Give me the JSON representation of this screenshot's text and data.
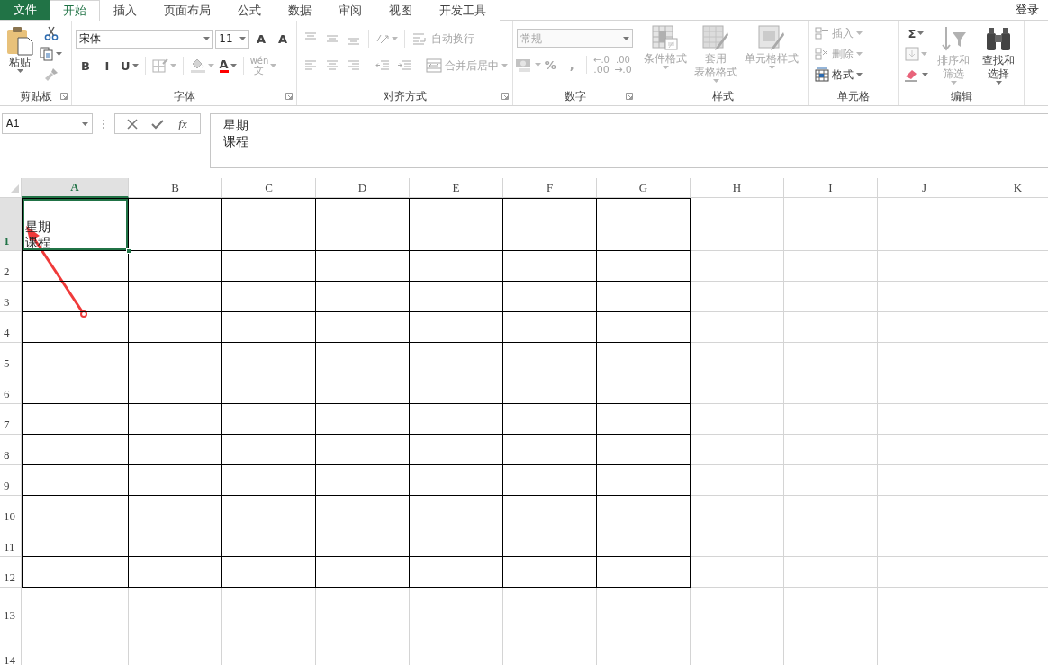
{
  "file_tab": "文件",
  "tabs": [
    {
      "label": "开始",
      "selected": true
    },
    {
      "label": "插入",
      "selected": false
    },
    {
      "label": "页面布局",
      "selected": false
    },
    {
      "label": "公式",
      "selected": false
    },
    {
      "label": "数据",
      "selected": false
    },
    {
      "label": "审阅",
      "selected": false
    },
    {
      "label": "视图",
      "selected": false
    },
    {
      "label": "开发工具",
      "selected": false
    }
  ],
  "account": "登录",
  "ribbon": [
    {
      "label": "剪贴板",
      "launcher": true,
      "stacks": [
        {
          "controls": [
            {
              "kind": "large",
              "lines": [
                "粘贴"
              ],
              "dropdown": true,
              "disabled": false
            }
          ]
        },
        {
          "controls": [
            {
              "kind": "icon",
              "disabled": false
            },
            {
              "kind": "icon",
              "dropdown": true,
              "disabled": false
            },
            {
              "kind": "icon",
              "disabled": true
            }
          ]
        }
      ]
    },
    {
      "label": "字体",
      "launcher": true,
      "lines": [
        {
          "controls": [
            {
              "kind": "combo",
              "value": "宋体",
              "wide": true,
              "disabled": false
            },
            {
              "kind": "combo",
              "value": "11",
              "disabled": false
            },
            {
              "kind": "glyph",
              "text": "A",
              "disabled": false
            },
            {
              "kind": "glyph",
              "text": "A",
              "disabled": false
            }
          ]
        },
        {
          "controls": [
            {
              "kind": "glyph",
              "text": "B",
              "disabled": false
            },
            {
              "kind": "glyph",
              "text": "I",
              "disabled": false
            },
            {
              "kind": "glyph",
              "text": "U",
              "dropdown": true,
              "disabled": false
            },
            {
              "kind": "separator"
            },
            {
              "kind": "icon",
              "dropdown": true,
              "disabled": true
            },
            {
              "kind": "separator"
            },
            {
              "kind": "icon",
              "dropdown": true,
              "disabled": true
            },
            {
              "kind": "glyph",
              "text": "A",
              "color": "#ff0000",
              "dropdown": true,
              "disabled": false
            },
            {
              "kind": "separator"
            },
            {
              "kind": "glyph",
              "text": "wén",
              "subtext": "文",
              "dropdown": true,
              "disabled": true
            }
          ]
        }
      ]
    },
    {
      "label": "对齐方式",
      "launcher": true,
      "lines": [
        {
          "controls": [
            {
              "kind": "icon",
              "disabled": true
            },
            {
              "kind": "icon",
              "disabled": true
            },
            {
              "kind": "icon",
              "disabled": true
            },
            {
              "kind": "separator"
            },
            {
              "kind": "icon",
              "dropdown": true,
              "disabled": true
            },
            {
              "kind": "separator"
            },
            {
              "kind": "small",
              "label": "自动换行",
              "disabled": true
            }
          ]
        },
        {
          "controls": [
            {
              "kind": "icon",
              "disabled": true
            },
            {
              "kind": "icon",
              "disabled": true
            },
            {
              "kind": "icon",
              "disabled": true
            },
            {
              "kind": "separator"
            },
            {
              "kind": "icon",
              "disabled": true
            },
            {
              "kind": "icon",
              "disabled": true
            },
            {
              "kind": "separator"
            },
            {
              "kind": "small",
              "label": "合并后居中",
              "dropdown": true,
              "disabled": true
            }
          ]
        }
      ]
    },
    {
      "label": "数字",
      "launcher": true,
      "lines": [
        {
          "controls": [
            {
              "kind": "combo",
              "value": "常规",
              "wide": true,
              "disabled": true
            }
          ]
        },
        {
          "controls": [
            {
              "kind": "icon",
              "dropdown": true,
              "disabled": true
            },
            {
              "kind": "glyph",
              "text": "%",
              "disabled": true
            },
            {
              "kind": "glyph",
              "text": ",",
              "disabled": true
            },
            {
              "kind": "separator"
            },
            {
              "kind": "glyph",
              "text": "←.0",
              "subtext": ".00",
              "disabled": true
            },
            {
              "kind": "glyph",
              "text": ".00",
              "subtext": "→.0",
              "disabled": true
            }
          ]
        }
      ]
    },
    {
      "label": "样式",
      "stacks": [
        {
          "controls": [
            {
              "kind": "large",
              "lines": [
                "条件格式"
              ],
              "dropdown": true,
              "disabled": true
            }
          ]
        },
        {
          "controls": [
            {
              "kind": "large",
              "lines": [
                "套用",
                "表格格式"
              ],
              "dropdown": true,
              "disabled": true
            }
          ]
        },
        {
          "controls": [
            {
              "kind": "large",
              "lines": [
                "单元格样式"
              ],
              "dropdown": true,
              "disabled": true
            }
          ]
        }
      ]
    },
    {
      "label": "单元格",
      "stacks": [
        {
          "controls": [
            {
              "kind": "small",
              "label": "插入",
              "dropdown": true,
              "disabled": true
            },
            {
              "kind": "small",
              "label": "删除",
              "dropdown": true,
              "disabled": true
            },
            {
              "kind": "small",
              "label": "格式",
              "dropdown": true,
              "disabled": false
            }
          ]
        }
      ]
    },
    {
      "label": "编辑",
      "stacks": [
        {
          "controls": [
            {
              "kind": "glyph",
              "text": "Σ",
              "dropdown": true,
              "disabled": false
            },
            {
              "kind": "icon",
              "dropdown": true,
              "disabled": true
            },
            {
              "kind": "icon",
              "dropdown": true,
              "disabled": false
            }
          ]
        },
        {
          "controls": [
            {
              "kind": "large",
              "lines": [
                "排序和筛选"
              ],
              "dropdown": true,
              "disabled": true
            }
          ]
        },
        {
          "controls": [
            {
              "kind": "large",
              "lines": [
                "查找和选择"
              ],
              "dropdown": true,
              "disabled": false
            }
          ]
        }
      ]
    }
  ],
  "formula_bar": {
    "name_box": "A1",
    "function_label": "fx",
    "content": [
      "星期",
      "课程"
    ]
  },
  "columns": [
    {
      "label": "A",
      "selected": true,
      "bordered": true
    },
    {
      "label": "B",
      "selected": false,
      "bordered": true
    },
    {
      "label": "C",
      "selected": false,
      "bordered": true
    },
    {
      "label": "D",
      "selected": false,
      "bordered": true
    },
    {
      "label": "E",
      "selected": false,
      "bordered": true
    },
    {
      "label": "F",
      "selected": false,
      "bordered": true
    },
    {
      "label": "G",
      "selected": false,
      "bordered": true
    },
    {
      "label": "H",
      "selected": false,
      "bordered": false
    },
    {
      "label": "I",
      "selected": false,
      "bordered": false
    },
    {
      "label": "J",
      "selected": false,
      "bordered": false
    },
    {
      "label": "K",
      "selected": false,
      "bordered": false
    }
  ],
  "rows": [
    {
      "label": "1",
      "selected": true,
      "bordered": true,
      "cells": [
        [
          "星期",
          "课程"
        ]
      ]
    },
    {
      "label": "2",
      "selected": false,
      "bordered": true
    },
    {
      "label": "3",
      "selected": false,
      "bordered": true
    },
    {
      "label": "4",
      "selected": false,
      "bordered": true
    },
    {
      "label": "5",
      "selected": false,
      "bordered": true
    },
    {
      "label": "6",
      "selected": false,
      "bordered": true
    },
    {
      "label": "7",
      "selected": false,
      "bordered": true
    },
    {
      "label": "8",
      "selected": false,
      "bordered": true
    },
    {
      "label": "9",
      "selected": false,
      "bordered": true
    },
    {
      "label": "10",
      "selected": false,
      "bordered": true
    },
    {
      "label": "11",
      "selected": false,
      "bordered": true
    },
    {
      "label": "12",
      "selected": false,
      "bordered": true
    },
    {
      "label": "13",
      "selected": false,
      "bordered": false
    },
    {
      "label": "14",
      "selected": false,
      "bordered": false
    }
  ],
  "annotation_arrow": true
}
